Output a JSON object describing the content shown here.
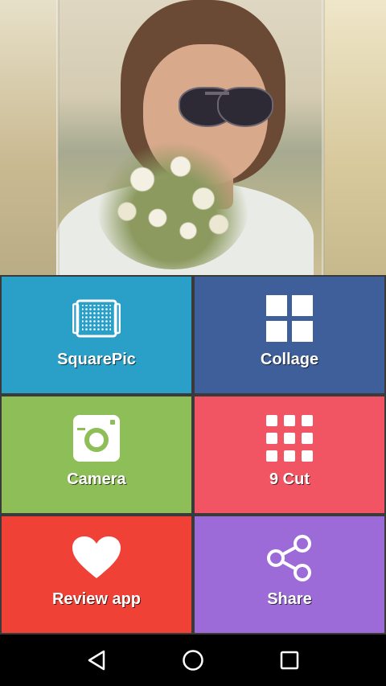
{
  "tiles": {
    "squarepic": {
      "label": "SquarePic",
      "icon": "squarepic-icon",
      "color": "#2a9fc8"
    },
    "collage": {
      "label": "Collage",
      "icon": "collage-grid-icon",
      "color": "#3e5f99"
    },
    "camera": {
      "label": "Camera",
      "icon": "camera-icon",
      "color": "#8dbe57"
    },
    "ninecut": {
      "label": "9 Cut",
      "icon": "nine-grid-icon",
      "color": "#f15462"
    },
    "review": {
      "label": "Review app",
      "icon": "heart-icon",
      "color": "#ef4136"
    },
    "share": {
      "label": "Share",
      "icon": "share-icon",
      "color": "#9c6bd8"
    }
  },
  "navbar": {
    "back": "back-icon",
    "home": "home-icon",
    "recents": "recents-icon"
  }
}
